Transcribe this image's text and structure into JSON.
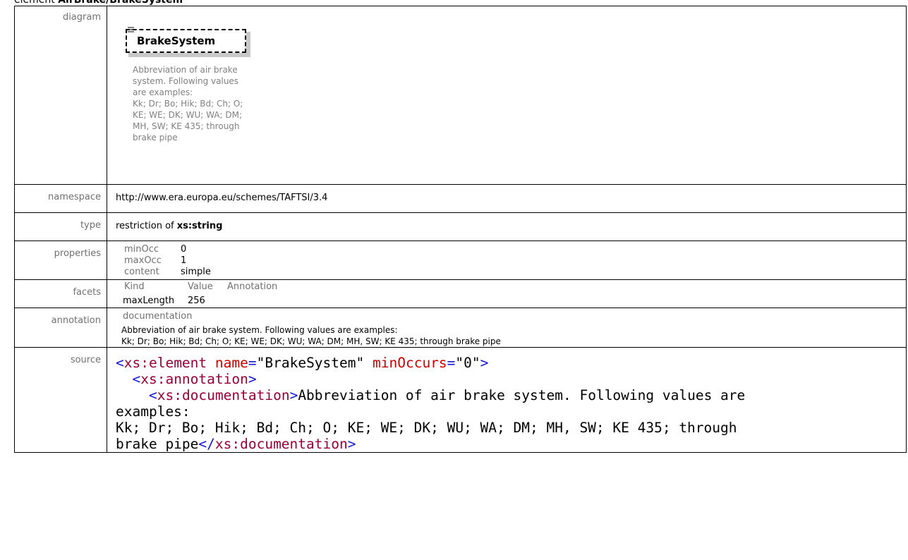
{
  "page_title": {
    "prefix": "element ",
    "name": "AirBrake/BrakeSystem"
  },
  "rows": {
    "diagram": {
      "label": "diagram"
    },
    "namespace": {
      "label": "namespace",
      "value": "http://www.era.europa.eu/schemes/TAFTSI/3.4"
    },
    "type": {
      "label": "type",
      "prefix": "restriction of ",
      "base": "xs:string"
    },
    "properties": {
      "label": "properties",
      "items": [
        {
          "key": "minOcc",
          "value": "0"
        },
        {
          "key": "maxOcc",
          "value": "1"
        },
        {
          "key": "content",
          "value": "simple"
        }
      ]
    },
    "facets": {
      "label": "facets",
      "headers": [
        "Kind",
        "Value",
        "Annotation"
      ],
      "row": {
        "kind": "maxLength",
        "value": "256",
        "annotation": ""
      }
    },
    "annotation": {
      "label": "annotation",
      "heading": "documentation",
      "text": "Abbreviation of air brake system. Following values are examples:\nKk; Dr; Bo; Hik; Bd; Ch; O; KE; WE; DK; WU; WA; DM; MH, SW; KE 435; through brake pipe"
    },
    "source": {
      "label": "source",
      "line1_tag": "xs:element",
      "line1_attr1": "name",
      "line1_val1": "\"BrakeSystem\"",
      "line1_attr2": "minOccurs",
      "line1_val2": "\"0\"",
      "line2_tag": "xs:annotation",
      "line3_tag": "xs:documentation",
      "line3_text": "Abbreviation of air brake system. Following values are",
      "line4_text": "examples:",
      "line5_text": "Kk; Dr; Bo; Hik; Bd; Ch; O; KE; WE; DK; WU; WA; DM; MH, SW; KE 435; through",
      "line6_text": "brake pipe",
      "line6_close_tag": "xs:documentation"
    }
  },
  "diagram": {
    "element_name": "BrakeSystem",
    "description": "Abbreviation of air brake\nsystem. Following values\nare examples:\nKk; Dr; Bo; Hik; Bd; Ch; O;\nKE; WE; DK; WU; WA; DM;\nMH, SW; KE 435; through\nbrake pipe",
    "icon": "element-lines-icon"
  }
}
